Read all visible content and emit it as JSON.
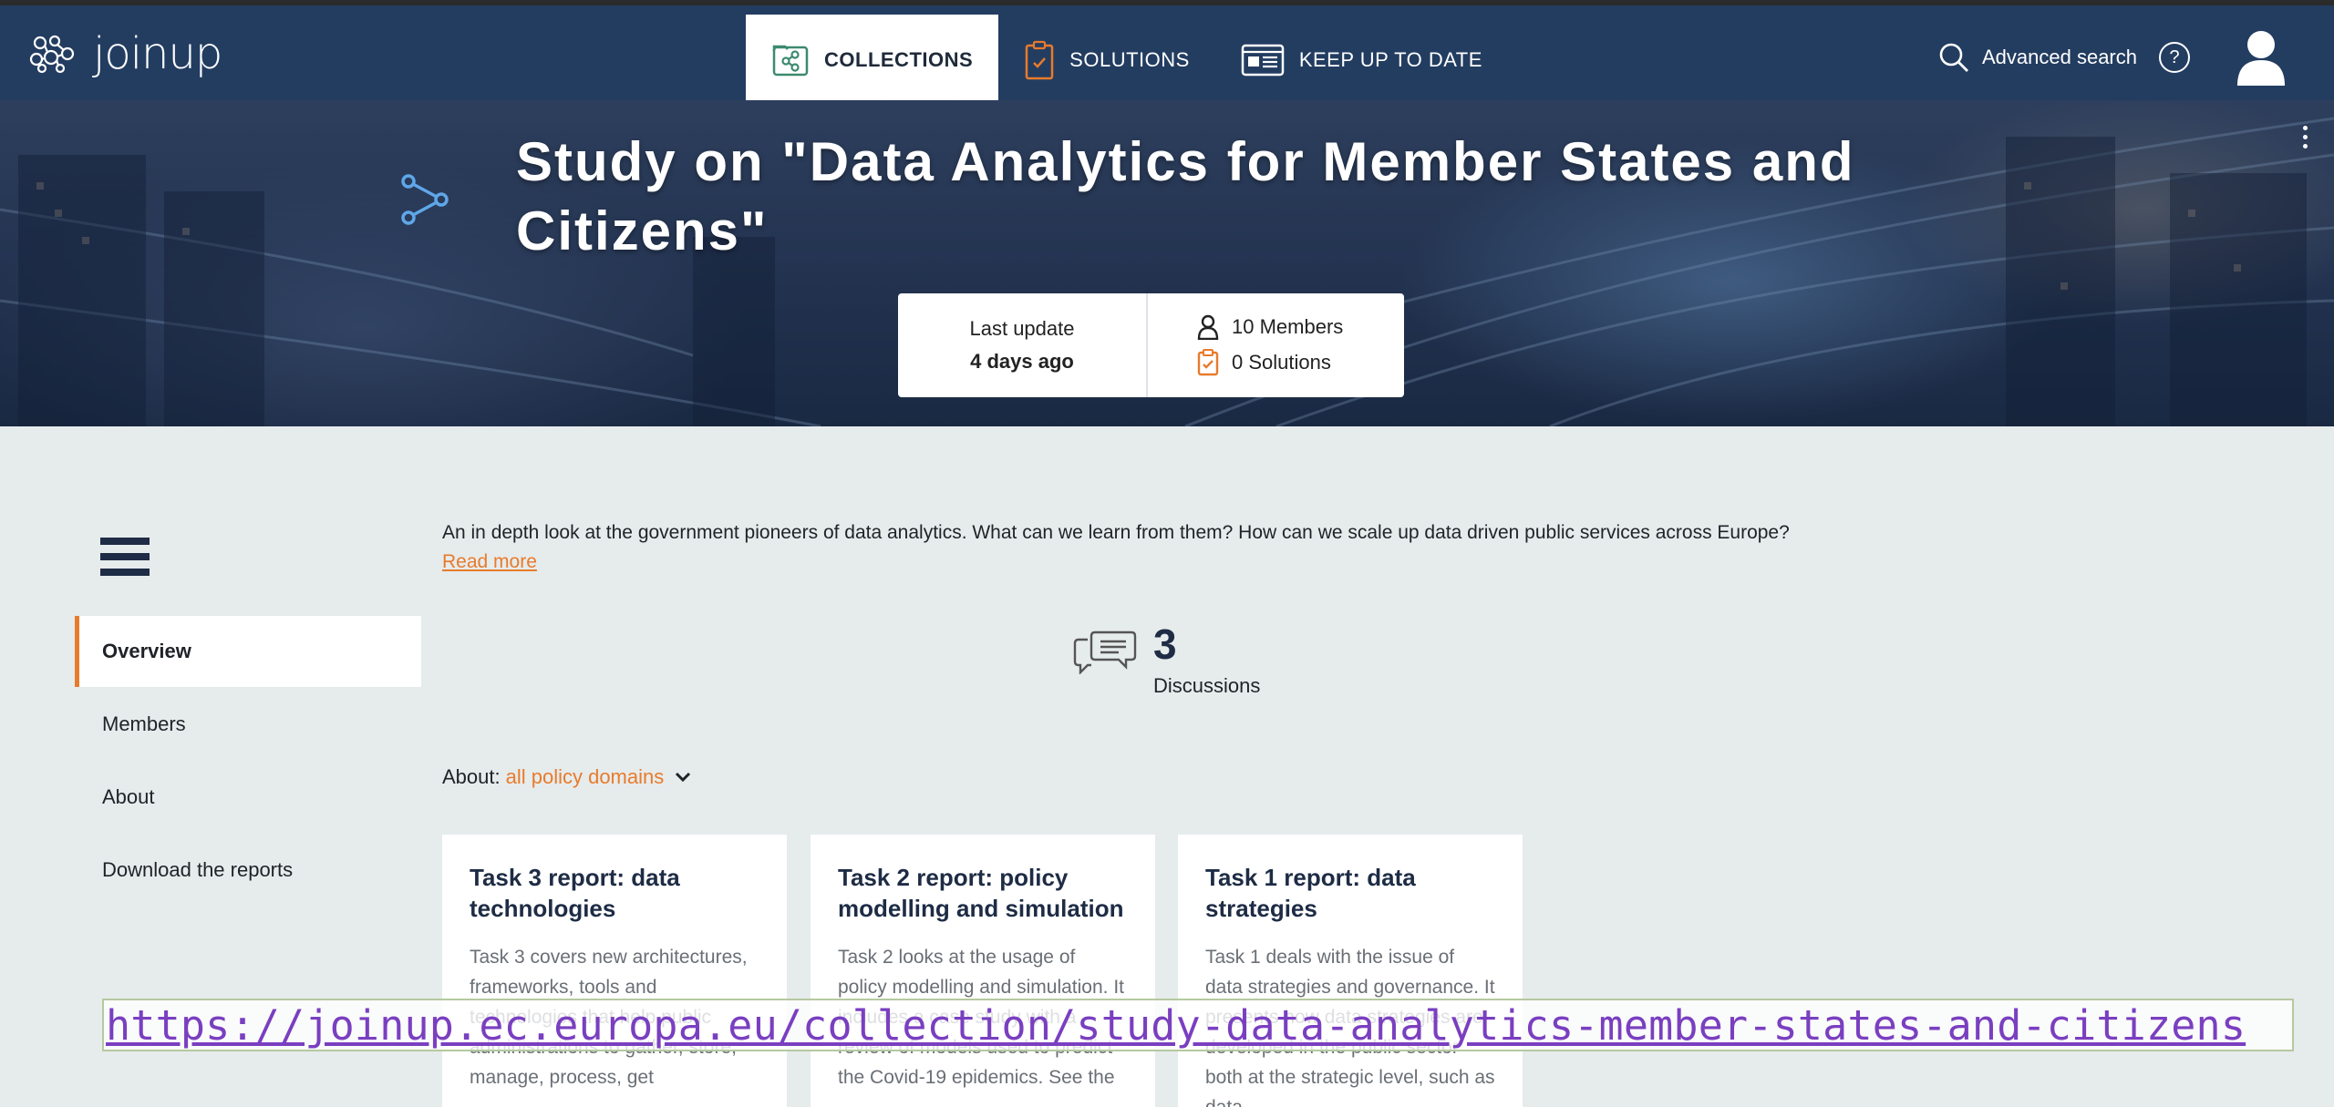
{
  "header": {
    "logo_text": "joinup",
    "nav": [
      {
        "label": "COLLECTIONS",
        "icon": "collections-icon"
      },
      {
        "label": "SOLUTIONS",
        "icon": "solutions-icon"
      },
      {
        "label": "KEEP UP TO DATE",
        "icon": "news-icon"
      }
    ],
    "advanced_search": "Advanced search",
    "help": "?"
  },
  "hero": {
    "title": "Study on \"Data Analytics for Member States and Citizens\"",
    "last_update_label": "Last update",
    "last_update_value": "4 days ago",
    "members": "10 Members",
    "solutions": "0 Solutions"
  },
  "sidebar": {
    "items": [
      {
        "label": "Overview",
        "active": true
      },
      {
        "label": "Members"
      },
      {
        "label": "About"
      },
      {
        "label": "Download the reports"
      }
    ]
  },
  "main": {
    "description": "An in depth look at the government pioneers of data analytics. What can we learn from them? How can we scale up data driven public services across Europe?",
    "read_more": "Read more",
    "discussions_count": "3",
    "discussions_label": "Discussions",
    "about_label": "About:",
    "about_value": "all policy domains",
    "cards": [
      {
        "title": "Task 3 report: data technologies",
        "text": "Task 3 covers new architectures, frameworks, tools and technologies that help public administrations to gather, store, manage, process, get"
      },
      {
        "title": "Task 2 report: policy modelling and simulation",
        "text": "Task 2 looks at the usage of policy modelling and simulation. It includes a case study with a review of models used to predict the Covid-19 epidemics. See the"
      },
      {
        "title": "Task 1 report: data strategies",
        "text": "Task 1 deals with the issue of data strategies and governance. It presents how data strategies are developed in the public sector both at the strategic level, such as data"
      }
    ]
  },
  "url_overlay": "https://joinup.ec.europa.eu/collection/study-data-analytics-member-states-and-citizens",
  "colors": {
    "nav_bg": "#233d61",
    "accent": "#e87b2b",
    "page_bg": "#e6ebec"
  }
}
